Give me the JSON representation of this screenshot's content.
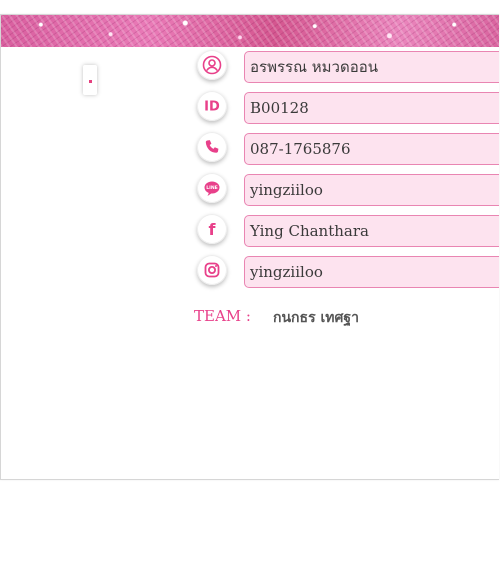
{
  "profile": {
    "name": "อรพรรณ  หมวดออน",
    "id": "B00128",
    "phone": "087-1765876",
    "line": "yingziiloo",
    "facebook": "Ying Chanthara",
    "instagram": "yingziiloo"
  },
  "team": {
    "label": "TEAM :",
    "value": "กนกธร เทศฐา"
  },
  "icons": {
    "id_text": "ID",
    "line_text": "LINE",
    "facebook_text": "f"
  },
  "colors": {
    "accent": "#e8408a",
    "field_bg": "#fde3ef",
    "field_border": "#e985b2"
  }
}
